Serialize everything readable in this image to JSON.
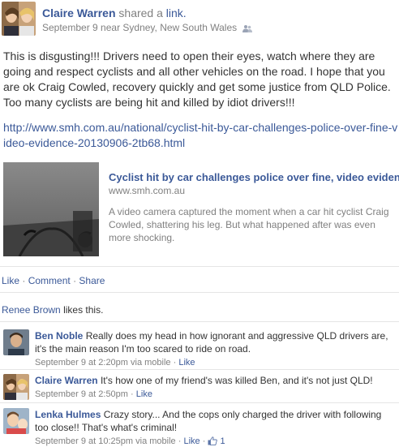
{
  "post": {
    "author": "Claire Warren",
    "shared_text": "shared a",
    "shared_link": "link.",
    "date": "September 9 near Sydney, New South Wales",
    "privacy_icon": "friends-icon",
    "status": "This is disgusting!!! Drivers need to open their eyes, watch where they are going and respect cyclists and all other vehicles on the road. I hope that you are ok Craig Cowled, recovery quickly and get some justice from QLD Police. Too many cyclists are being hit and killed by idiot drivers!!!",
    "url": "http://www.smh.com.au/national/cyclist-hit-by-car-challenges-police-over-fine-video-evidence-20130906-2tb68.html"
  },
  "attachment": {
    "title": "Cyclist hit by car challenges police over fine, video evidence",
    "domain": "www.smh.com.au",
    "description": "A video camera captured the moment when a car hit cyclist Craig Cowled, shattering his leg. But what happened after was even more shocking."
  },
  "actions": {
    "like": "Like",
    "comment": "Comment",
    "share": "Share",
    "separator": "·"
  },
  "likes": {
    "name": "Renee Brown",
    "text": "likes this."
  },
  "comments": [
    {
      "name": "Ben Noble",
      "text": "Really does my head in how ignorant and aggressive QLD drivers are, it's the main reason I'm too scared to ride on road.",
      "time": "September 9 at 2:20pm via mobile",
      "like": "Like"
    },
    {
      "name": "Claire Warren",
      "text": "It's how one of my friend's was killed Ben, and it's not just QLD!",
      "time": "September 9 at 2:50pm",
      "like": "Like"
    },
    {
      "name": "Lenka Hulmes",
      "text": "Crazy story... And the cops only charged the driver with following too close!! That's what's criminal!",
      "time": "September 9 at 10:25pm via mobile",
      "like": "Like",
      "like_count": "1"
    }
  ],
  "colors": {
    "link": "#3b5998",
    "meta": "#808080",
    "text": "#333333",
    "divider": "#e5e5e5"
  }
}
